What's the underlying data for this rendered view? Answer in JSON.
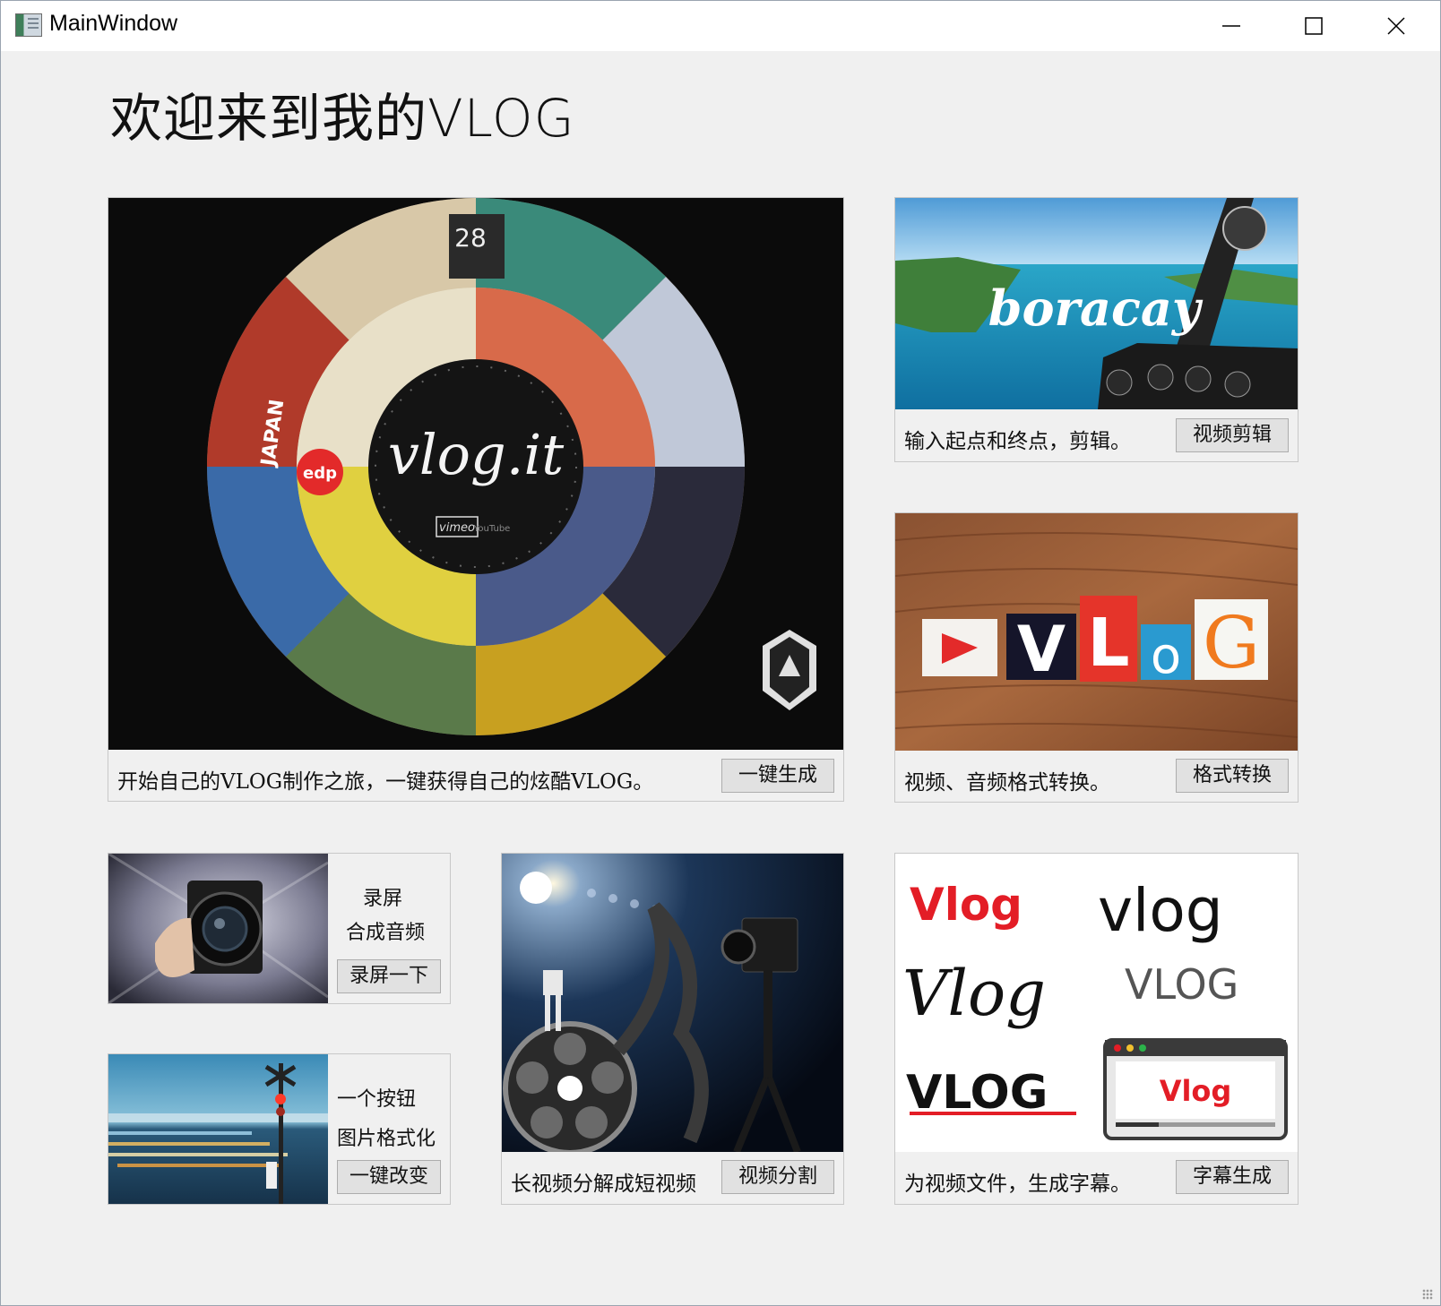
{
  "window": {
    "title": "MainWindow"
  },
  "heading": "欢迎来到我的VLOG",
  "cards": {
    "generate": {
      "caption": "开始自己的VLOG制作之旅，一键获得自己的炫酷VLOG。",
      "button": "一键生成",
      "image_text": "vlog.it",
      "image_words": [
        "JAPAN",
        "edp",
        "28",
        "vimeo",
        "YouTube"
      ]
    },
    "clip": {
      "caption": "输入起点和终点，剪辑。",
      "button": "视频剪辑",
      "image_text": "boracay"
    },
    "convert": {
      "caption": "视频、音频格式转换。",
      "button": "格式转换",
      "image_letters": [
        "V",
        "L",
        "o",
        "G"
      ]
    },
    "record": {
      "line1": "录屏",
      "line2": "合成音频",
      "button": "录屏一下"
    },
    "image_format": {
      "line1": "一个按钮",
      "line2": "图片格式化",
      "button": "一键改变"
    },
    "split": {
      "caption": "长视频分解成短视频",
      "button": "视频分割"
    },
    "subtitle": {
      "caption": "为视频文件，生成字幕。",
      "button": "字幕生成",
      "logos": [
        "Vlog",
        "vlog",
        "Vlog",
        "VLOG",
        "VLOG",
        "Vlog"
      ]
    }
  },
  "colors": {
    "window_bg": "#f0f0f0",
    "button_bg": "#e1e1e1",
    "vlog_red": "#e8202a"
  },
  "icons": [
    "app-window-icon",
    "minimize-icon",
    "maximize-icon",
    "close-icon",
    "resize-grip-icon"
  ]
}
